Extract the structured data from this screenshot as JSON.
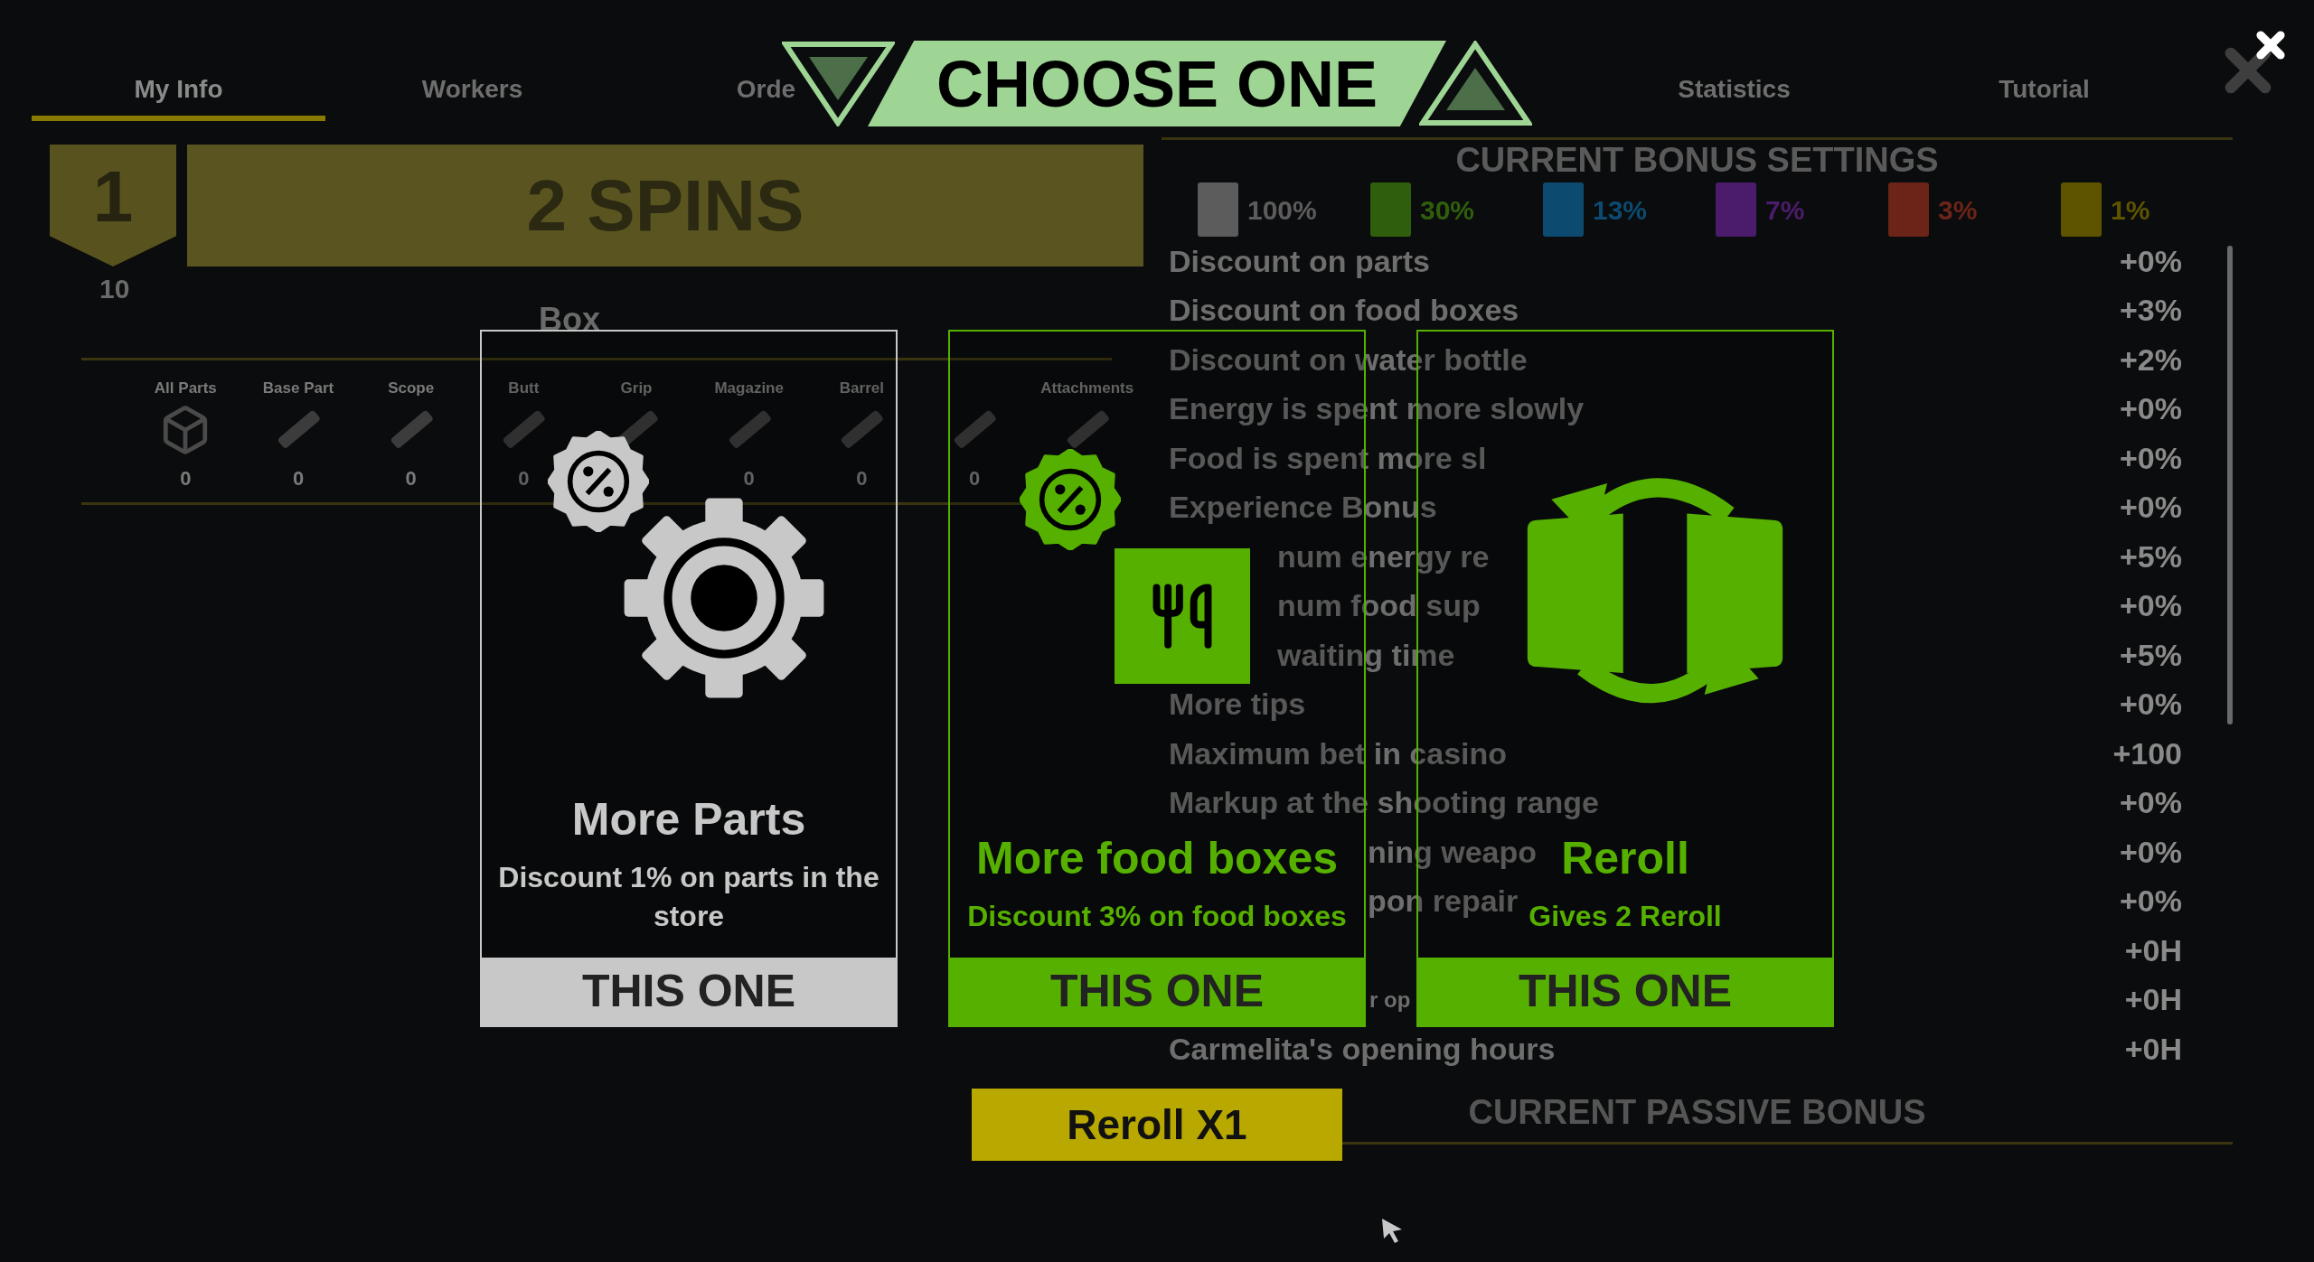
{
  "tabs": [
    {
      "label": "My Info",
      "selected": true
    },
    {
      "label": "Workers",
      "selected": false
    },
    {
      "label": "Orde",
      "selected": false
    },
    {
      "label": "Statistics",
      "selected": false
    },
    {
      "label": "Tutorial",
      "selected": false
    }
  ],
  "level": {
    "number": "1",
    "spins": "2 SPINS",
    "count": "10"
  },
  "box": {
    "title": "Box",
    "categories": [
      {
        "label": "All Parts",
        "count": "0"
      },
      {
        "label": "Base Part",
        "count": "0"
      },
      {
        "label": "Scope",
        "count": "0"
      },
      {
        "label": "Butt",
        "count": "0"
      },
      {
        "label": "Grip"
      },
      {
        "label": "Magazine",
        "count": "0"
      },
      {
        "label": "Barrel",
        "count": "0"
      },
      {
        "count": "0"
      },
      {
        "label": "Attachments"
      }
    ]
  },
  "bonus_settings": {
    "title": "CURRENT BONUS SETTINGS",
    "rarities": [
      {
        "percent": "100%",
        "color": "#5c5c5c"
      },
      {
        "percent": "30%",
        "color": "#2f5e0c"
      },
      {
        "percent": "13%",
        "color": "#0c4a70"
      },
      {
        "percent": "7%",
        "color": "#4c1c6c"
      },
      {
        "percent": "3%",
        "color": "#6c2418"
      },
      {
        "percent": "1%",
        "color": "#5e5400"
      }
    ],
    "rows": [
      {
        "kind": "full",
        "label": "Discount on parts",
        "value": "+0%"
      },
      {
        "kind": "full",
        "label": "Discount on food boxes",
        "value": "+3%"
      },
      {
        "kind": "full",
        "label": "Discount on water bottle",
        "value": "+2%"
      },
      {
        "kind": "full",
        "label": "Energy is spent more slowly",
        "value": "+0%"
      },
      {
        "kind": "full",
        "label": "Food is spent more sl",
        "value": "+0%"
      },
      {
        "kind": "full",
        "label": "Experience Bonus",
        "value": "+0%"
      },
      {
        "kind": "behind_icon",
        "label": "num energy re",
        "value": "+5%"
      },
      {
        "kind": "behind_icon",
        "label": "num food sup",
        "value": "+0%"
      },
      {
        "kind": "behind_icon",
        "label": "waiting time",
        "value": "+5%"
      },
      {
        "kind": "full",
        "label": "More tips",
        "value": "+0%"
      },
      {
        "kind": "full",
        "label": "Maximum bet in casino",
        "value": "+100"
      },
      {
        "kind": "full",
        "label": "Markup at the shooting range",
        "value": "+0%"
      },
      {
        "kind": "behind_title",
        "label": "ning weapo",
        "value": "+0%"
      },
      {
        "kind": "behind_title",
        "label": "pon repair",
        "value": "+0%"
      },
      {
        "kind": "value_only",
        "value": "+0H"
      },
      {
        "kind": "between_bars",
        "label": "r op",
        "value": "+0H"
      },
      {
        "kind": "full",
        "label": "Carmelita's opening hours",
        "value": "+0H"
      }
    ]
  },
  "passive_bonus": {
    "title": "CURRENT PASSIVE BONUS"
  },
  "dialog": {
    "title": "CHOOSE ONE",
    "cards": [
      {
        "kind": "parts",
        "title": "More Parts",
        "description": "Discount 1% on parts in the store",
        "button": "THIS ONE",
        "color": "#c8c8c8"
      },
      {
        "kind": "food",
        "title": "More food boxes",
        "description": "Discount 3% on food boxes",
        "button": "THIS ONE",
        "color": "#56b000"
      },
      {
        "kind": "reroll",
        "title": "Reroll",
        "description": "Gives 2 Reroll",
        "button": "THIS ONE",
        "color": "#56b000"
      }
    ],
    "reroll_button": "Reroll X1"
  }
}
